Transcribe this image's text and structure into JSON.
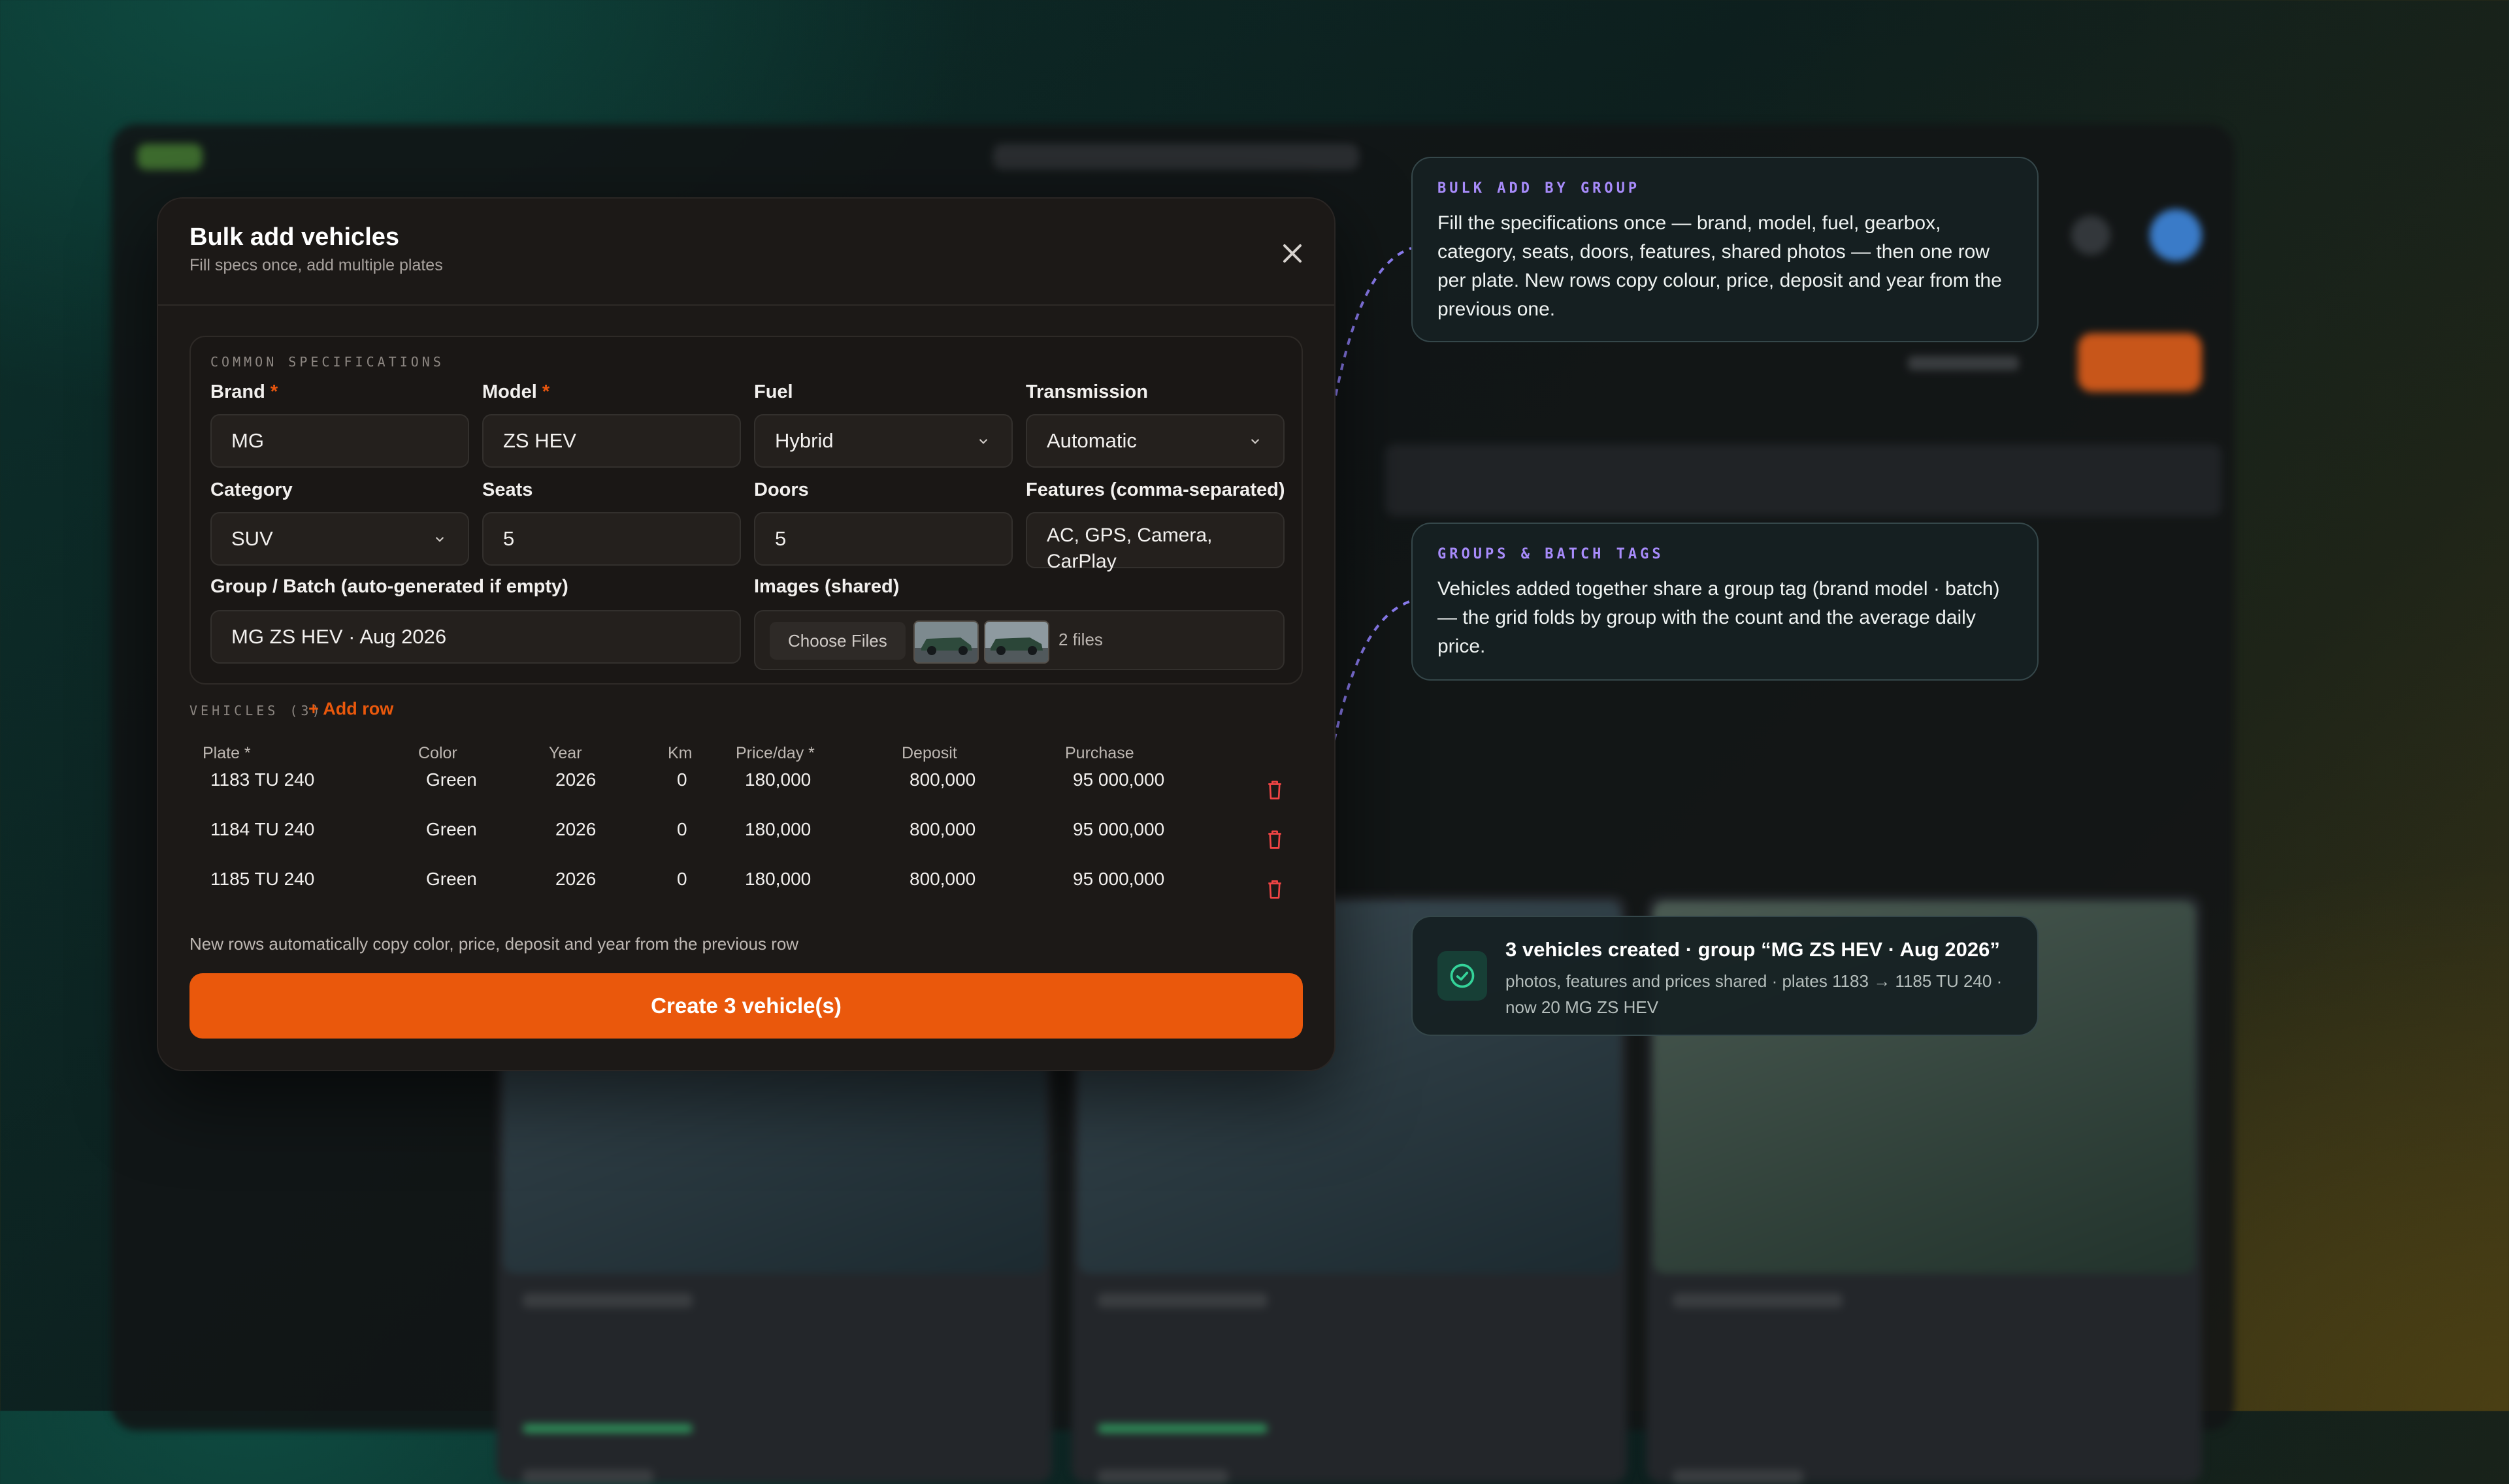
{
  "modal": {
    "title": "Bulk add vehicles",
    "subtitle": "Fill specs once, add multiple plates",
    "close_icon": "close-icon",
    "specs": {
      "heading": "COMMON SPECIFICATIONS",
      "brand": {
        "label": "Brand",
        "required": "*",
        "value": "MG"
      },
      "model": {
        "label": "Model",
        "required": "*",
        "value": "ZS HEV"
      },
      "fuel": {
        "label": "Fuel",
        "value": "Hybrid"
      },
      "transmission": {
        "label": "Transmission",
        "value": "Automatic"
      },
      "category": {
        "label": "Category",
        "value": "SUV"
      },
      "seats": {
        "label": "Seats",
        "value": "5"
      },
      "doors": {
        "label": "Doors",
        "value": "5"
      },
      "features": {
        "label": "Features (comma-separated)",
        "value": "AC, GPS, Camera, CarPlay"
      },
      "group": {
        "label": "Group / Batch (auto-generated if empty)",
        "value": "MG ZS HEV · Aug 2026"
      },
      "images": {
        "label": "Images (shared)",
        "choose_label": "Choose Files",
        "file_count": "2 files"
      }
    },
    "vehicles": {
      "heading": "VEHICLES (3)",
      "add_row_label": "+ Add row",
      "columns": [
        "Plate *",
        "Color",
        "Year",
        "Km",
        "Price/day *",
        "Deposit",
        "Purchase"
      ],
      "rows": [
        {
          "plate": "1183 TU 240",
          "color": "Green",
          "year": "2026",
          "km": "0",
          "price": "180,000",
          "deposit": "800,000",
          "purchase": "95 000,000"
        },
        {
          "plate": "1184 TU 240",
          "color": "Green",
          "year": "2026",
          "km": "0",
          "price": "180,000",
          "deposit": "800,000",
          "purchase": "95 000,000"
        },
        {
          "plate": "1185 TU 240",
          "color": "Green",
          "year": "2026",
          "km": "0",
          "price": "180,000",
          "deposit": "800,000",
          "purchase": "95 000,000"
        }
      ],
      "row_icon": "trash-icon"
    },
    "note": "New rows automatically copy color, price, deposit and year from the previous row",
    "create_label": "Create 3 vehicle(s)"
  },
  "callouts": [
    {
      "tag": "BULK ADD BY GROUP",
      "body": "Fill the specifications once — brand, model, fuel, gearbox, category, seats, doors, features, shared photos — then one row per plate. New rows copy colour, price, deposit and year from the previous one."
    },
    {
      "tag": "GROUPS & BATCH TAGS",
      "body": "Vehicles added together share a group tag (brand model · batch) — the grid folds by group with the count and the average daily price."
    }
  ],
  "toast": {
    "icon": "check-circle-icon",
    "title": "3 vehicles created · group “MG ZS HEV · Aug 2026”",
    "subtitle": "photos, features and prices shared · plates 1183 → 1185 TU 240 · now 20 MG ZS HEV"
  },
  "colors": {
    "accent": "#ea580c",
    "callout_tag": "#a78bfa",
    "success": "#34d399",
    "danger": "#ef4444"
  }
}
